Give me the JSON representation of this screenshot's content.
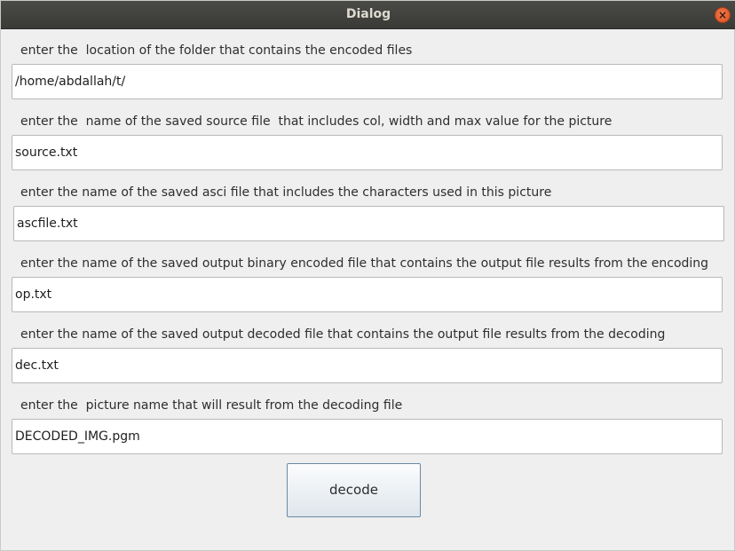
{
  "window": {
    "title": "Dialog",
    "close_glyph": "×"
  },
  "form": {
    "fields": [
      {
        "label": "enter the  location of the folder that contains the encoded files",
        "value": "/home/abdallah/t/"
      },
      {
        "label": "enter the  name of the saved source file  that includes col, width and max value for the picture",
        "value": "source.txt"
      },
      {
        "label": "enter the name of the saved asci file that includes the characters used in this picture",
        "value": "ascfile.txt"
      },
      {
        "label": "enter the name of the saved output binary encoded file that contains the output file results from the encoding",
        "value": "op.txt"
      },
      {
        "label": "enter the name of the saved output decoded file that contains the output file results from the decoding",
        "value": "dec.txt"
      },
      {
        "label": "enter the  picture name that will result from the decoding file",
        "value": "DECODED_IMG.pgm"
      }
    ]
  },
  "actions": {
    "decode_label": "decode"
  }
}
